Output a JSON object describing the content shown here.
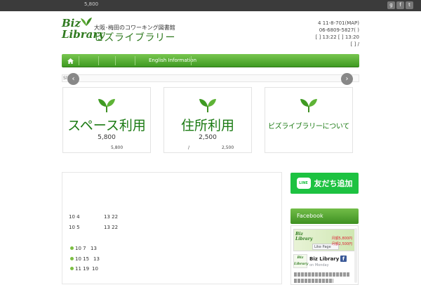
{
  "colors": {
    "brand_green": "#3f9a22",
    "title_green": "#1a7a12",
    "line_green": "#1dc241",
    "topbar": "#3b3b3b"
  },
  "topbar": {
    "message": "5,800",
    "social_icons": [
      "google-plus-icon",
      "facebook-icon",
      "twitter-icon"
    ]
  },
  "logo": {
    "biz": "Biz",
    "library": "Library",
    "subtitle": "大阪･梅田のコワーキング図書館",
    "name": "ビズライブラリー"
  },
  "header_info": {
    "address": "4  11-8-701(MAP)",
    "phone": "06-6809-5827(   )",
    "hours_1": "[  ] 13:22  [  ] 13:20",
    "hours_2": "[  ]  /"
  },
  "nav": {
    "items": [
      "English Information"
    ]
  },
  "slider": {
    "label": "Slid"
  },
  "cards": [
    {
      "title": "スペース利用",
      "price": "5,800",
      "caption": "5,800"
    },
    {
      "title": "住所利用",
      "price": "2,500",
      "caption_left": "/",
      "caption": "2,500"
    },
    {
      "title": "ビズライブラリーについて"
    }
  ],
  "schedule": {
    "rows": [
      {
        "date": "10  4",
        "time": "13    22"
      },
      {
        "date": "10  5",
        "time": "13    22"
      }
    ],
    "events": [
      {
        "date": "10  7",
        "time": "13"
      },
      {
        "date": "10  15",
        "time": "13"
      },
      {
        "date": "11  19",
        "time": "10"
      }
    ]
  },
  "sidebar": {
    "line_button": {
      "badge": "LINE",
      "label": "友だち追加"
    },
    "facebook": {
      "heading": "Facebook",
      "page_name": "Biz Library",
      "page_sub": "on Monday",
      "like_label": "Like Page",
      "cover_price_1": "月額5,800円",
      "cover_price_2": "月額2,500円",
      "mini_logo_1": "Biz",
      "mini_logo_2": "Library"
    }
  }
}
